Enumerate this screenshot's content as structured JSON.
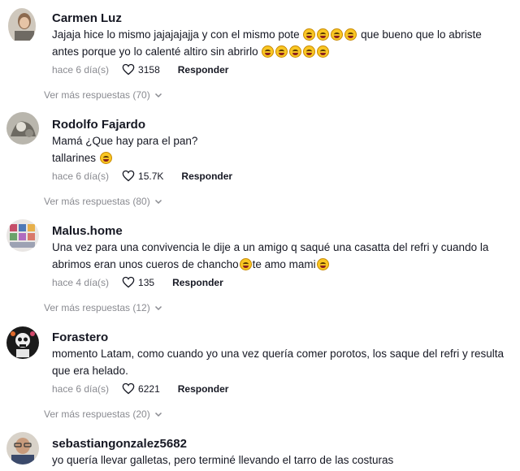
{
  "comments": [
    {
      "username": "Carmen Luz",
      "text_1": "Jajaja hice lo mismo jajajajajja y con el mismo pote ",
      "text_2": " que bueno que lo abriste antes porque yo lo calenté altiro sin abrirlo ",
      "date": "hace 6 día(s)",
      "likes": "3158",
      "reply_label": "Responder",
      "more_replies": "Ver más respuestas (70)"
    },
    {
      "username": "Rodolfo Fajardo",
      "text_line1": "Mamá ¿Que hay para el pan?",
      "text_line2": "tallarines ",
      "date": "hace 6 día(s)",
      "likes": "15.7K",
      "reply_label": "Responder",
      "more_replies": "Ver más respuestas (80)"
    },
    {
      "username": "Malus.home",
      "text_1": "Una vez para una convivencia le dije a un amigo q saqué una casatta del refri y cuando la abrimos eran unos cueros de chancho",
      "text_2": "te amo mami",
      "date": "hace 4 día(s)",
      "likes": "135",
      "reply_label": "Responder",
      "more_replies": "Ver más respuestas (12)"
    },
    {
      "username": "Forastero",
      "text": "momento Latam, como cuando yo una vez quería comer porotos, los saque del refri y resulta que era helado.",
      "date": "hace 6 día(s)",
      "likes": "6221",
      "reply_label": "Responder",
      "more_replies": "Ver más respuestas (20)"
    },
    {
      "username": "sebastiangonzalez5682",
      "text": "yo quería llevar galletas, pero terminé llevando el tarro de las costuras"
    }
  ],
  "icons": {
    "like": "heart-outline-icon",
    "expand": "chevron-down-icon",
    "emoji": "rolling-on-floor-laughing-emoji"
  }
}
